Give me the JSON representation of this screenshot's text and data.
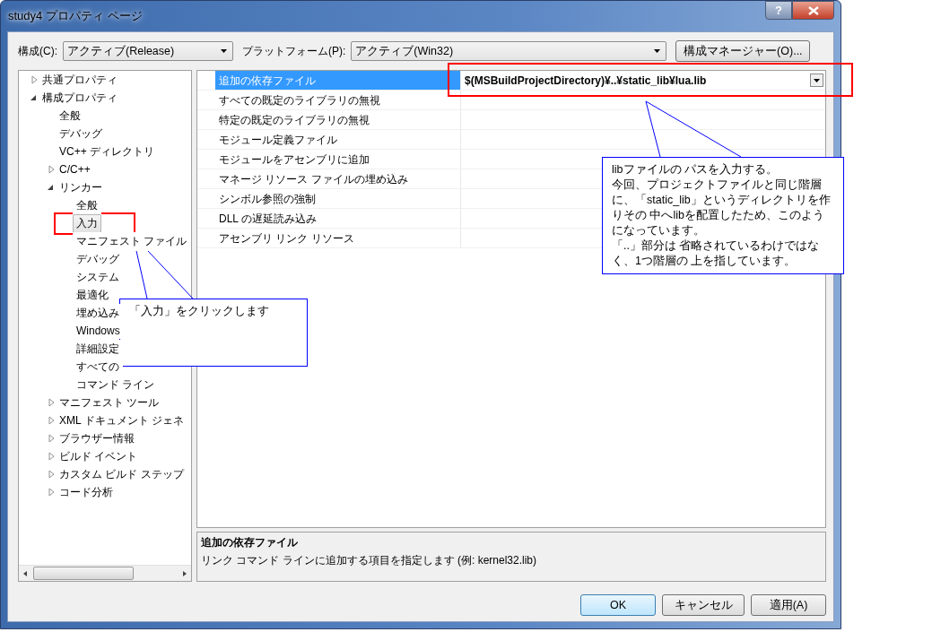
{
  "window": {
    "title": "study4 プロパティ ページ",
    "help_button": "?"
  },
  "toolbar": {
    "config_label": "構成(C):",
    "config_value": "アクティブ(Release)",
    "platform_label": "プラットフォーム(P):",
    "platform_value": "アクティブ(Win32)",
    "manager_button": "構成マネージャー(O)..."
  },
  "tree": [
    {
      "label": "共通プロパティ",
      "expanded": false,
      "selected": false
    },
    {
      "label": "構成プロパティ",
      "expanded": true,
      "selected": false,
      "children": [
        {
          "label": "全般",
          "selected": false
        },
        {
          "label": "デバッグ",
          "selected": false
        },
        {
          "label": "VC++ ディレクトリ",
          "selected": false
        },
        {
          "label": "C/C++",
          "expanded": false,
          "selected": false
        },
        {
          "label": "リンカー",
          "expanded": true,
          "selected": false,
          "children": [
            {
              "label": "全般",
              "selected": false
            },
            {
              "label": "入力",
              "selected": true
            },
            {
              "label": "マニフェスト ファイル",
              "selected": false
            },
            {
              "label": "デバッグ",
              "selected": false
            },
            {
              "label": "システム",
              "selected": false
            },
            {
              "label": "最適化",
              "selected": false
            },
            {
              "label": "埋め込み",
              "selected": false
            },
            {
              "label": "Windows",
              "selected": false
            },
            {
              "label": "詳細設定",
              "selected": false
            },
            {
              "label": "すべての",
              "selected": false
            },
            {
              "label": "コマンド ライン",
              "selected": false
            }
          ]
        },
        {
          "label": "マニフェスト ツール",
          "expanded": false,
          "selected": false
        },
        {
          "label": "XML ドキュメント ジェネ",
          "expanded": false,
          "selected": false
        },
        {
          "label": "ブラウザー情報",
          "expanded": false,
          "selected": false
        },
        {
          "label": "ビルド イベント",
          "expanded": false,
          "selected": false
        },
        {
          "label": "カスタム ビルド ステップ",
          "expanded": false,
          "selected": false
        },
        {
          "label": "コード分析",
          "expanded": false,
          "selected": false
        }
      ]
    }
  ],
  "properties": [
    {
      "name": "追加の依存ファイル",
      "value": "$(MSBuildProjectDirectory)¥..¥static_lib¥lua.lib",
      "selected": true
    },
    {
      "name": "すべての既定のライブラリの無視",
      "selected": false
    },
    {
      "name": "特定の既定のライブラリの無視",
      "selected": false
    },
    {
      "name": "モジュール定義ファイル",
      "selected": false
    },
    {
      "name": "モジュールをアセンブリに追加",
      "selected": false
    },
    {
      "name": "マネージ リソース ファイルの埋め込み",
      "selected": false
    },
    {
      "name": "シンボル参照の強制",
      "selected": false
    },
    {
      "name": "DLL の遅延読み込み",
      "selected": false
    },
    {
      "name": "アセンブリ リンク リソース",
      "selected": false
    }
  ],
  "description": {
    "title": "追加の依存ファイル",
    "text": "リンク コマンド ラインに追加する項目を指定します (例: kernel32.lib)"
  },
  "buttons": [
    {
      "label": "OK",
      "default": true
    },
    {
      "label": "キャンセル",
      "default": false
    },
    {
      "label": "適用(A)",
      "default": false
    }
  ],
  "callouts": [
    {
      "text": [
        "「入力」をクリックします"
      ]
    },
    {
      "text": [
        "libファイルの パスを入力する。",
        "今回、プロジェクトファイルと同じ階層に、「static_lib」というディレクトリを作りその 中へlibを配置したため、このようになっています。",
        "「..」部分は 省略されているわけではなく、1つ階層の 上を指しています。"
      ]
    }
  ]
}
